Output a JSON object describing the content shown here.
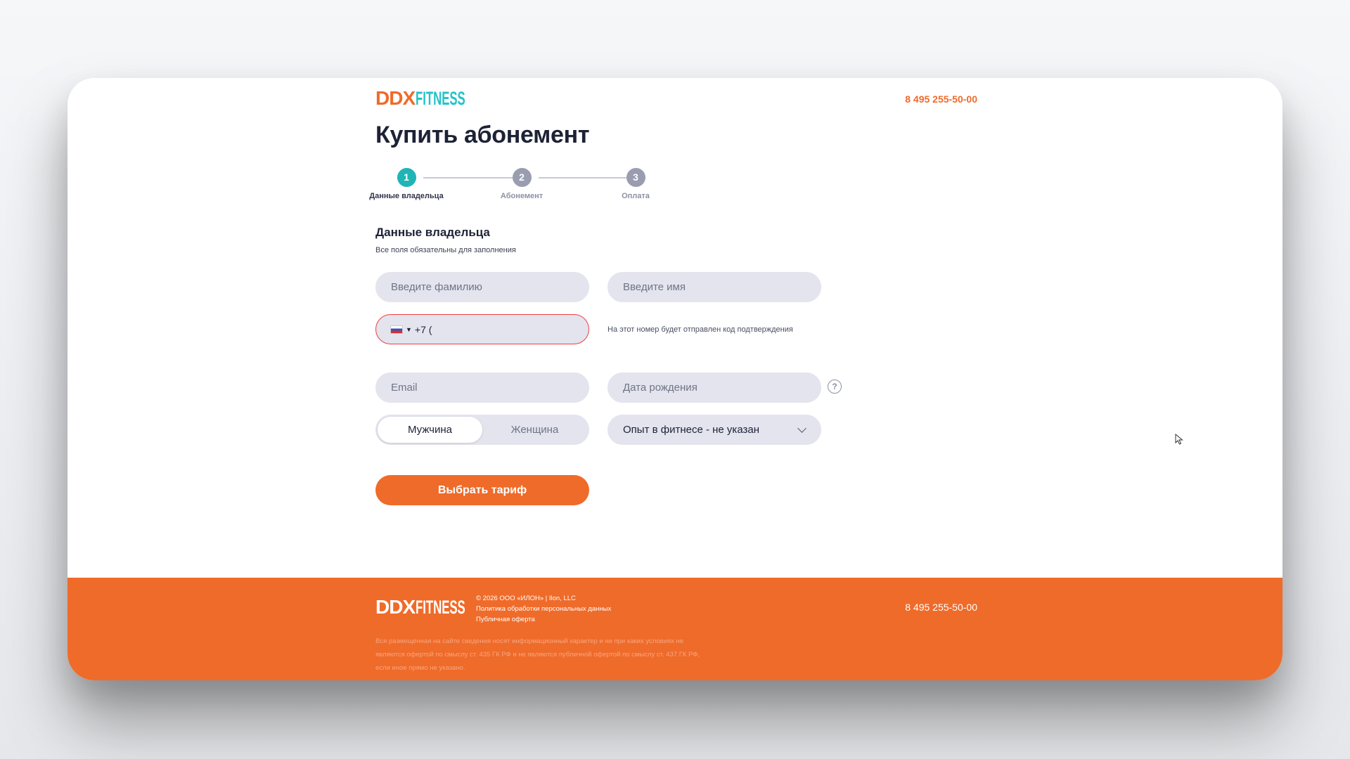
{
  "header": {
    "logo_part1": "DDX",
    "logo_part2": "FITNESS",
    "phone": "8 495 255-50-00"
  },
  "page_title": "Купить абонемент",
  "stepper": {
    "steps": [
      {
        "number": "1",
        "label": "Данные владельца",
        "active": true
      },
      {
        "number": "2",
        "label": "Абонемент",
        "active": false
      },
      {
        "number": "3",
        "label": "Оплата",
        "active": false
      }
    ]
  },
  "form": {
    "section_title": "Данные владельца",
    "section_subtitle": "Все поля обязательны для заполнения",
    "surname_placeholder": "Введите фамилию",
    "name_placeholder": "Введите имя",
    "phone_prefix": "+7 (",
    "phone_hint": "На этот номер будет отправлен код подтверждения",
    "email_placeholder": "Email",
    "birthdate_placeholder": "Дата рождения",
    "help_symbol": "?",
    "gender_options": [
      "Мужчина",
      "Женщина"
    ],
    "gender_selected": "Мужчина",
    "experience_value": "Опыт в фитнесе - не указан",
    "submit_label": "Выбрать тариф"
  },
  "footer": {
    "logo_part1": "DDX",
    "logo_part2": "FITNESS",
    "copyright": "© 2026 ООО «ИЛОН» | Ilon, LLC",
    "privacy_link": "Политика обработки персональных данных",
    "offer_link": "Публичная оферта",
    "phone": "8 495 255-50-00",
    "disclaimer": "Вся размещенная на сайте сведения носят информационный характер и ни при каких условиях не являются офертой по смыслу ст. 435 ГК РФ и не являются публичной офертой по смыслу ст. 437 ГК РФ, если иное прямо не указано."
  },
  "colors": {
    "brand_orange": "#ef6b2a",
    "brand_teal": "#1fb4b6",
    "error_red": "#ef3e45"
  }
}
